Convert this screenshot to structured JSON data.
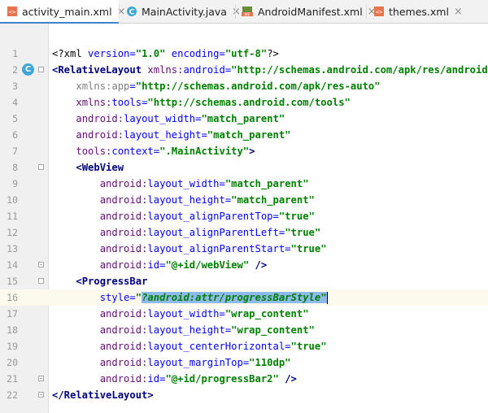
{
  "tabs": [
    {
      "label": "activity_main.xml",
      "icon": "xml-file-icon",
      "active": true
    },
    {
      "label": "MainActivity.java",
      "icon": "java-class-icon",
      "active": false
    },
    {
      "label": "AndroidManifest.xml",
      "icon": "manifest-file-icon",
      "active": false
    },
    {
      "label": "themes.xml",
      "icon": "xml-file-icon",
      "active": false
    }
  ],
  "tab_close_glyph": "×",
  "gutter_class_icon": "C",
  "current_line": 16,
  "lines": [
    {
      "n": "1",
      "t": "<?xml version=\"1.0\" encoding=\"utf-8\"?>"
    },
    {
      "n": "2",
      "t": "<RelativeLayout xmlns:android=\"http://schemas.android.com/apk/res/android\""
    },
    {
      "n": "3",
      "t": "    xmlns:app=\"http://schemas.android.com/apk/res-auto\""
    },
    {
      "n": "4",
      "t": "    xmlns:tools=\"http://schemas.android.com/tools\""
    },
    {
      "n": "5",
      "t": "    android:layout_width=\"match_parent\""
    },
    {
      "n": "6",
      "t": "    android:layout_height=\"match_parent\""
    },
    {
      "n": "7",
      "t": "    tools:context=\".MainActivity\">"
    },
    {
      "n": "8",
      "t": "    <WebView"
    },
    {
      "n": "9",
      "t": "        android:layout_width=\"match_parent\""
    },
    {
      "n": "10",
      "t": "        android:layout_height=\"match_parent\""
    },
    {
      "n": "11",
      "t": "        android:layout_alignParentTop=\"true\""
    },
    {
      "n": "12",
      "t": "        android:layout_alignParentLeft=\"true\""
    },
    {
      "n": "13",
      "t": "        android:layout_alignParentStart=\"true\""
    },
    {
      "n": "14",
      "t": "        android:id=\"@+id/webView\" />"
    },
    {
      "n": "15",
      "t": "    <ProgressBar"
    },
    {
      "n": "16",
      "t": "        style=\"?android:attr/progressBarStyle\""
    },
    {
      "n": "17",
      "t": "        android:layout_width=\"wrap_content\""
    },
    {
      "n": "18",
      "t": "        android:layout_height=\"wrap_content\""
    },
    {
      "n": "19",
      "t": "        android:layout_centerHorizontal=\"true\""
    },
    {
      "n": "20",
      "t": "        android:layout_marginTop=\"110dp\""
    },
    {
      "n": "21",
      "t": "        android:id=\"@+id/progressBar2\" />"
    },
    {
      "n": "22",
      "t": "</RelativeLayout>"
    }
  ],
  "colors": {
    "tag": "#000080",
    "namespace": "#660e7a",
    "attribute": "#0000ff",
    "value": "#008000",
    "selection": "#8fbaf0",
    "current_line": "#fcfaed",
    "tab_accent": "#4083c9"
  }
}
